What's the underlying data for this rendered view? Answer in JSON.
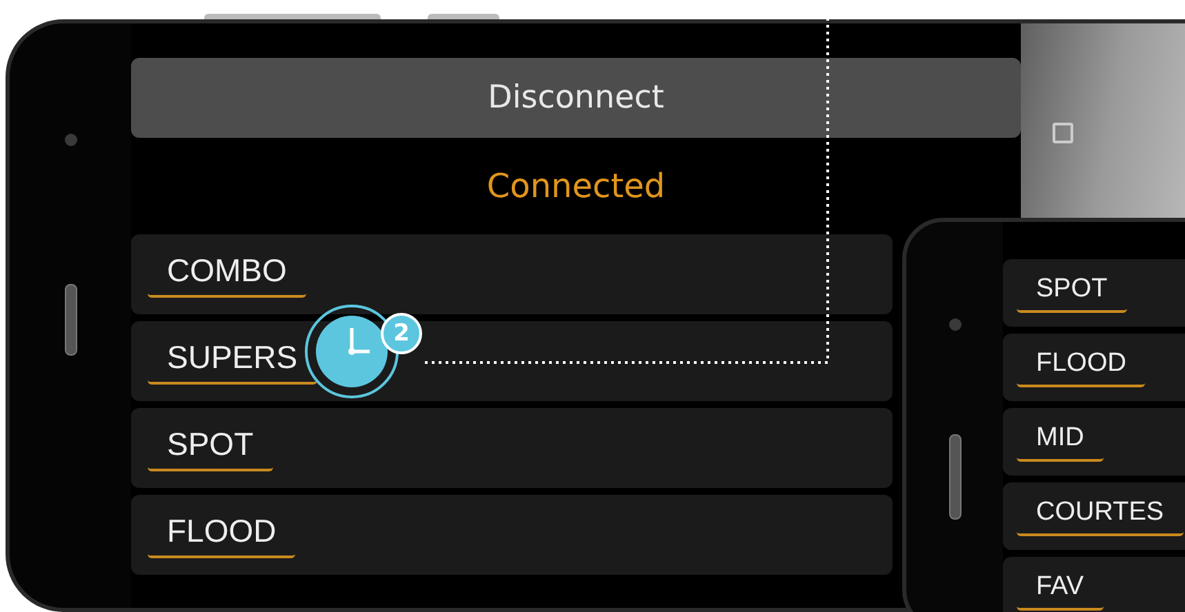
{
  "main_phone": {
    "disconnect_button": "Disconnect",
    "status": "Connected",
    "modes": [
      {
        "label": "COMBO"
      },
      {
        "label": "SUPERS"
      },
      {
        "label": "SPOT"
      },
      {
        "label": "FLOOD"
      }
    ]
  },
  "second_phone": {
    "modes": [
      {
        "label": "SPOT"
      },
      {
        "label": "FLOOD"
      },
      {
        "label": "MID"
      },
      {
        "label": "COURTES"
      },
      {
        "label": "FAV"
      }
    ]
  },
  "callout": {
    "badge": "2"
  }
}
